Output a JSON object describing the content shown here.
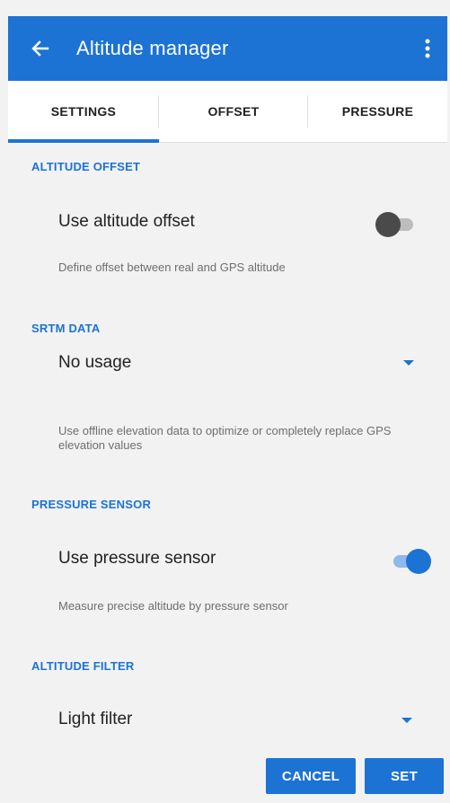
{
  "appbar": {
    "title": "Altitude manager",
    "back_icon": "arrow-left-icon",
    "menu_icon": "more-vert-icon",
    "color": "#1c73d4"
  },
  "tabs": [
    {
      "label": "SETTINGS",
      "selected": true
    },
    {
      "label": "OFFSET",
      "selected": false
    },
    {
      "label": "PRESSURE",
      "selected": false
    }
  ],
  "sections": {
    "altitude_offset": {
      "header": "ALTITUDE OFFSET",
      "title": "Use altitude offset",
      "description": "Define offset between real and GPS altitude",
      "switch_on": false
    },
    "srtm_data": {
      "header": "SRTM DATA",
      "value": "No usage",
      "description": "Use offline elevation data to optimize or completely replace GPS elevation values"
    },
    "pressure_sensor": {
      "header": "PRESSURE SENSOR",
      "title": "Use pressure sensor",
      "description": "Measure precise altitude by pressure sensor",
      "switch_on": true
    },
    "altitude_filter": {
      "header": "ALTITUDE FILTER",
      "value": "Light filter"
    }
  },
  "buttons": {
    "cancel": "CANCEL",
    "set": "SET"
  },
  "colors": {
    "accent": "#1c73d4",
    "background": "#f2f2f2",
    "switch_off": "#4a4a4a"
  }
}
